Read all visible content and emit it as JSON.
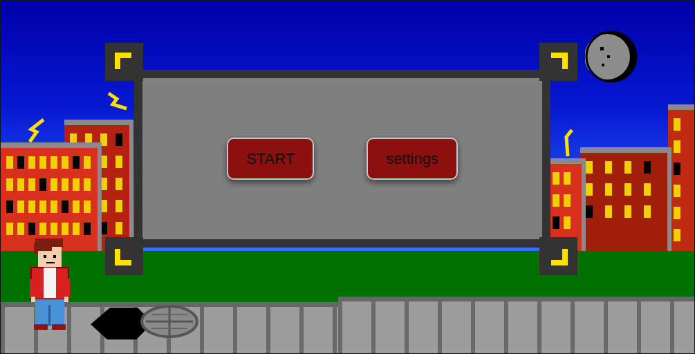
{
  "menu": {
    "buttons": [
      {
        "label": "START"
      },
      {
        "label": "settings"
      }
    ]
  }
}
